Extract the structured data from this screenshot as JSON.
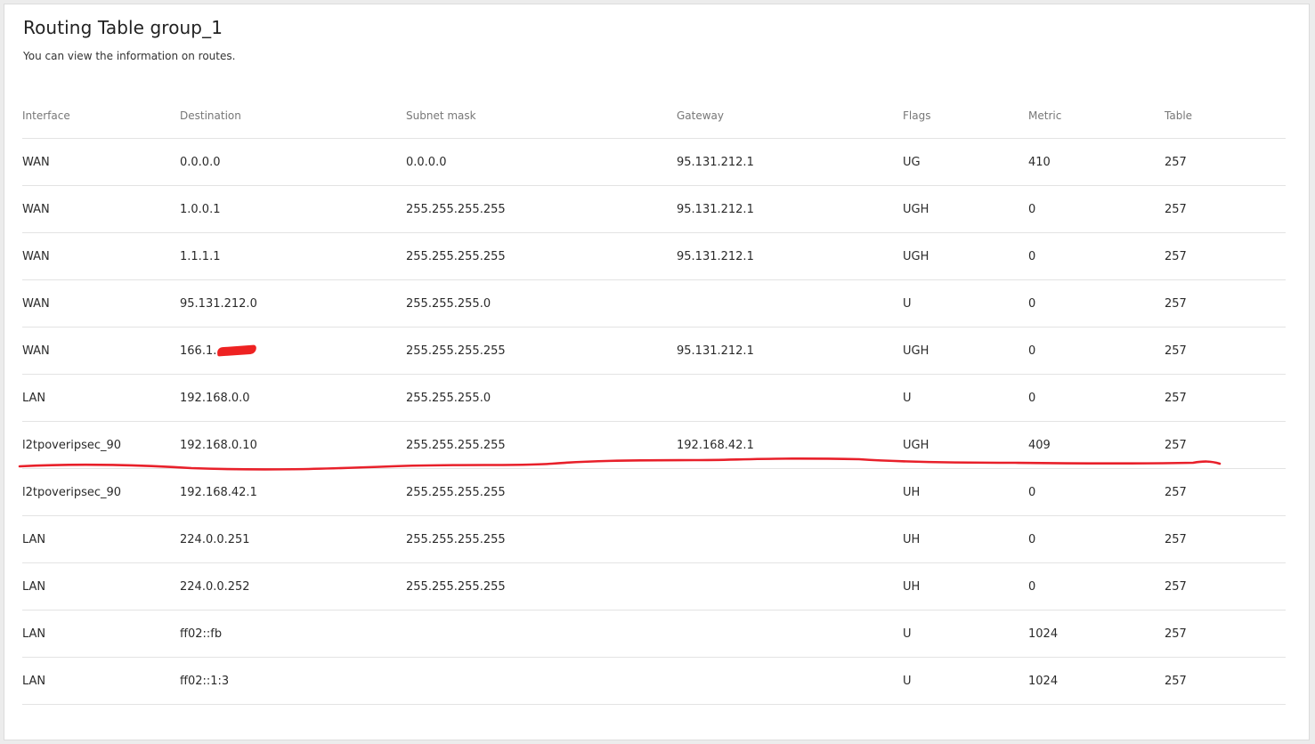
{
  "page": {
    "title": "Routing Table group_1",
    "subtitle": "You can view the information on routes."
  },
  "table": {
    "columns": [
      "Interface",
      "Destination",
      "Subnet mask",
      "Gateway",
      "Flags",
      "Metric",
      "Table"
    ],
    "rows": [
      [
        "WAN",
        "0.0.0.0",
        "0.0.0.0",
        "95.131.212.1",
        "UG",
        "410",
        "257"
      ],
      [
        "WAN",
        "1.0.0.1",
        "255.255.255.255",
        "95.131.212.1",
        "UGH",
        "0",
        "257"
      ],
      [
        "WAN",
        "1.1.1.1",
        "255.255.255.255",
        "95.131.212.1",
        "UGH",
        "0",
        "257"
      ],
      [
        "WAN",
        "95.131.212.0",
        "255.255.255.0",
        "",
        "U",
        "0",
        "257"
      ],
      [
        "WAN",
        "166.1.",
        "255.255.255.255",
        "95.131.212.1",
        "UGH",
        "0",
        "257"
      ],
      [
        "LAN",
        "192.168.0.0",
        "255.255.255.0",
        "",
        "U",
        "0",
        "257"
      ],
      [
        "l2tpoveripsec_90",
        "192.168.0.10",
        "255.255.255.255",
        "192.168.42.1",
        "UGH",
        "409",
        "257"
      ],
      [
        "l2tpoveripsec_90",
        "192.168.42.1",
        "255.255.255.255",
        "",
        "UH",
        "0",
        "257"
      ],
      [
        "LAN",
        "224.0.0.251",
        "255.255.255.255",
        "",
        "UH",
        "0",
        "257"
      ],
      [
        "LAN",
        "224.0.0.252",
        "255.255.255.255",
        "",
        "UH",
        "0",
        "257"
      ],
      [
        "LAN",
        "ff02::fb",
        "",
        "",
        "U",
        "1024",
        "257"
      ],
      [
        "LAN",
        "ff02::1:3",
        "",
        "",
        "U",
        "1024",
        "257"
      ]
    ]
  },
  "colors": {
    "annotation": "#e8202a",
    "text": "#2a2a2a",
    "header_text": "#777777",
    "divider": "#e3e3e3"
  }
}
